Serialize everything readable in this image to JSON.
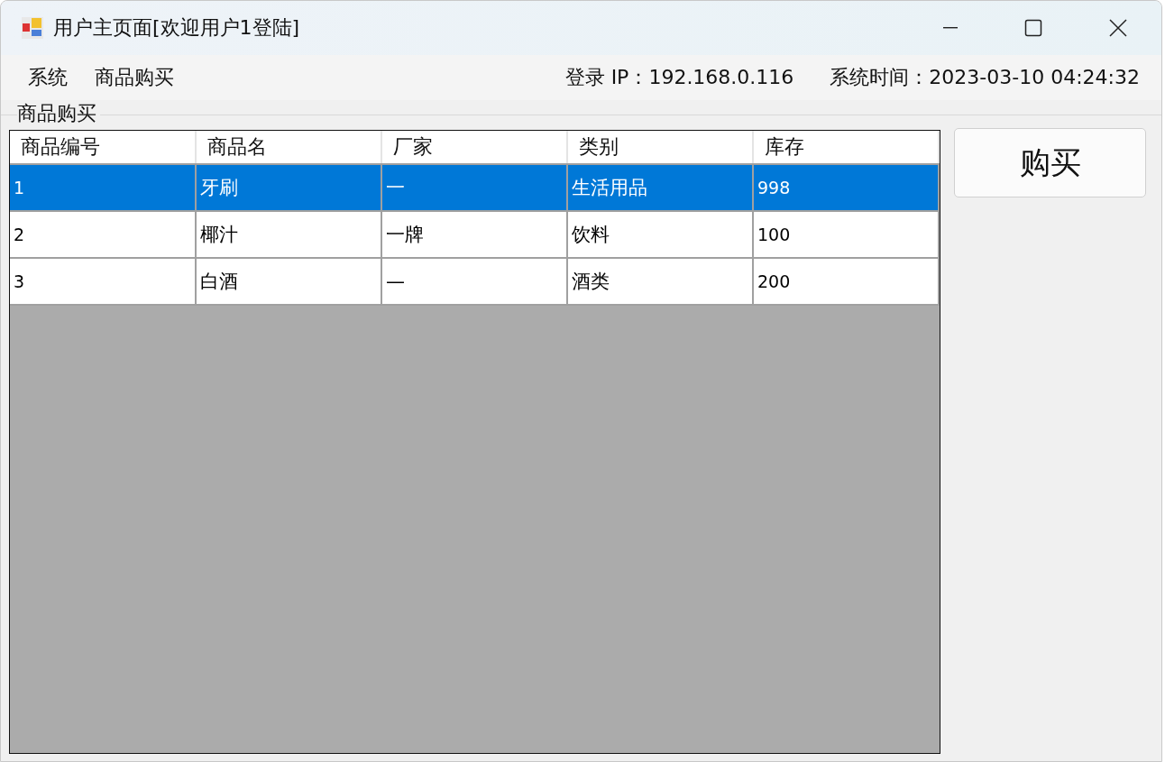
{
  "window": {
    "title": "用户主页面[欢迎用户1登陆]"
  },
  "menu": [
    "系统",
    "商品购买"
  ],
  "status": {
    "ip": "登录 IP：192.168.0.116",
    "time": "系统时间：2023-03-10 04:24:32"
  },
  "group": {
    "title": "商品购买"
  },
  "table": {
    "columns": [
      "商品编号",
      "商品名",
      "厂家",
      "类别",
      "库存"
    ],
    "rows": [
      {
        "cells": [
          "1",
          "牙刷",
          "一",
          "生活用品",
          "998"
        ],
        "selected": true
      },
      {
        "cells": [
          "2",
          "椰汁",
          "一牌",
          "饮料",
          "100"
        ],
        "selected": false
      },
      {
        "cells": [
          "3",
          "白酒",
          "—",
          "酒类",
          "200"
        ],
        "selected": false
      }
    ]
  },
  "buttons": [
    "购买"
  ]
}
